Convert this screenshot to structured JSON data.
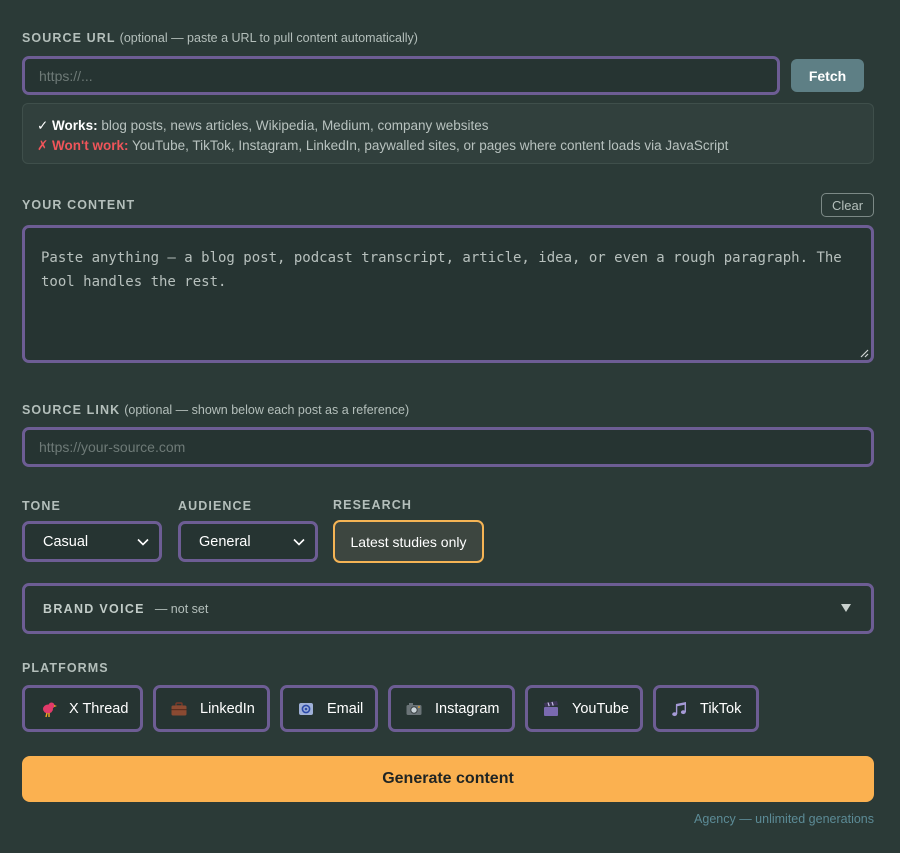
{
  "source_url": {
    "label": "SOURCE URL",
    "hint": "(optional — paste a URL to pull content automatically)",
    "placeholder": "https://...",
    "fetch_label": "Fetch"
  },
  "info": {
    "works_label": "✓ Works:",
    "works_text": "blog posts, news articles, Wikipedia, Medium, company websites",
    "wont_label": "✗ Won't work:",
    "wont_text": "YouTube, TikTok, Instagram, LinkedIn, paywalled sites, or pages where content loads via JavaScript"
  },
  "content": {
    "label": "YOUR CONTENT",
    "clear_label": "Clear",
    "placeholder": "Paste anything — a blog post, podcast transcript, article, idea, or even a rough paragraph. The tool handles the rest."
  },
  "source_link": {
    "label": "SOURCE LINK",
    "hint": "(optional — shown below each post as a reference)",
    "placeholder": "https://your-source.com"
  },
  "tone": {
    "label": "TONE",
    "value": "Casual"
  },
  "audience": {
    "label": "AUDIENCE",
    "value": "General"
  },
  "research": {
    "label": "RESEARCH",
    "value": "Latest studies only"
  },
  "brand_voice": {
    "label": "BRAND VOICE",
    "status": "— not set"
  },
  "platforms": {
    "label": "PLATFORMS",
    "items": [
      {
        "label": "X Thread",
        "icon": "bird-icon"
      },
      {
        "label": "LinkedIn",
        "icon": "briefcase-icon"
      },
      {
        "label": "Email",
        "icon": "email-icon"
      },
      {
        "label": "Instagram",
        "icon": "camera-icon"
      },
      {
        "label": "YouTube",
        "icon": "clapperboard-icon"
      },
      {
        "label": "TikTok",
        "icon": "music-note-icon"
      }
    ]
  },
  "generate_label": "Generate content",
  "footer_note": "Agency — unlimited generations",
  "colors": {
    "background": "#2b3a37",
    "field_border": "#6d5d94",
    "accent": "#fbb150",
    "fetch_button": "#5e7f85",
    "error": "#f0555a"
  }
}
